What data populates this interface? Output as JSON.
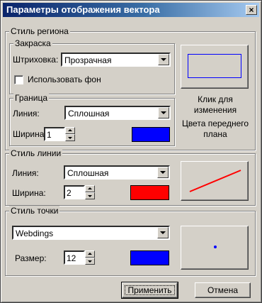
{
  "window": {
    "title": "Параметры отображения вектора",
    "close_label": "×"
  },
  "region_style": {
    "legend": "Стиль региона",
    "fill": {
      "legend": "Закраска",
      "hatch_label": "Штриховка:",
      "hatch_value": "Прозрачная",
      "use_background_label": "Использовать фон",
      "use_background_checked": false
    },
    "border": {
      "legend": "Граница",
      "line_label": "Линия:",
      "line_value": "Сплошная",
      "width_label": "Ширина:",
      "width_value": "1",
      "color": "#0000ff"
    },
    "preview_border_color": "#0000ff",
    "hint_line1": "Клик для",
    "hint_line2": "изменения",
    "hint_line3": "Цвета переднего",
    "hint_line4": "плана"
  },
  "line_style": {
    "legend": "Стиль линии",
    "line_label": "Линия:",
    "line_value": "Сплошная",
    "width_label": "Ширина:",
    "width_value": "2",
    "color": "#ff0000"
  },
  "point_style": {
    "legend": "Стиль точки",
    "font_value": "Webdings",
    "size_label": "Размер:",
    "size_value": "12",
    "color": "#0000ff"
  },
  "buttons": {
    "apply": "Применить",
    "cancel": "Отмена"
  }
}
